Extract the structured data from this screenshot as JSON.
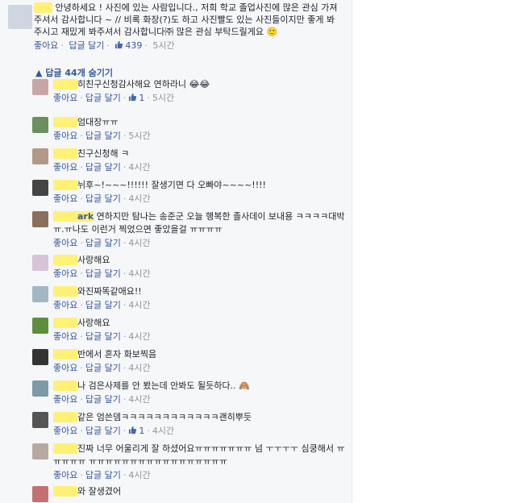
{
  "main_comment": {
    "text": "안녕하세요 ! 사진에 있는 사람입니다., 저희 학교 졸업사진에 많은 관심 가져주셔서 감사합니다 ~ // 비록 화장(?)도 하고 사진빨도 있는 사진들이지만 좋게 봐주시고 재밌게 봐주셔서 감사합니다㈜ 많은 관심 부탁드릴게요 🙂",
    "like_label": "좋아요",
    "reply_label": "답글 달기",
    "likes": "439",
    "time": "5시간"
  },
  "replies_toggle": "답글 44개 숨기기",
  "replies": [
    {
      "name": "",
      "text": "히친구신청감사해요 연하라니 😂😂",
      "likes": "1",
      "time": "5시간",
      "avatar_color": "#c9a6a6"
    },
    {
      "name": "",
      "text": "엄대장ㅠㅠ",
      "likes": "",
      "time": "5시간",
      "avatar_color": "#6b8f5e"
    },
    {
      "name": "",
      "text": "친구신청해 ㅋ",
      "likes": "",
      "time": "4시간",
      "avatar_color": "#b49a86"
    },
    {
      "name": "",
      "text": "뉘후~!~~~!!!!!! 잘생기면 다 오빠야~~~~!!!!",
      "likes": "",
      "time": "4시간",
      "avatar_color": "#444444"
    },
    {
      "name": "ark",
      "text": "연하지만 탐나는 송준군 오늘 행복한 졸사데이 보내용 ㅋㅋㅋㅋ대박 ㅠ.ㅠ나도 이런거 찍었으면 좋았을걸 ㅠㅠㅠㅠ",
      "likes": "",
      "time": "4시간",
      "avatar_color": "#8a6f5a"
    },
    {
      "name": "",
      "text": "사랑해요",
      "likes": "",
      "time": "4시간",
      "avatar_color": "#d7c4d9"
    },
    {
      "name": "",
      "text": "와진짜똑같애요!!",
      "likes": "",
      "time": "4시간",
      "avatar_color": "#a3b6c4"
    },
    {
      "name": "",
      "text": "사랑해요",
      "likes": "",
      "time": "4시간",
      "avatar_color": "#5e8f3e"
    },
    {
      "name": "",
      "text": "반에서 혼자 화보찍음",
      "likes": "",
      "time": "4시간",
      "avatar_color": "#333333"
    },
    {
      "name": "",
      "text": "나 검은사제를 안 봤는데 안봐도 될듯하다.. 🙈",
      "likes": "",
      "time": "4시간",
      "avatar_color": "#7c9aa8"
    },
    {
      "name": "",
      "text": "같은 엄쓴뎀ㅋㅋㅋㅋㅋㅋㅋㅋㅋㅋㅋㅋ괜히뿌듯",
      "likes": "1",
      "time": "4시간",
      "avatar_color": "#555555"
    },
    {
      "name": "",
      "text": "진짜 너무 어울리게 잘 하셨어요ㅠㅠㅠㅠㅠㅠㅠ 넘 ㅜㅜㅜㅜ 심쿵해서 ㅠㅠㅠㅠㅠ ㅠㅠㅠㅠㅠㅠㅠㅠㅠㅠㅠㅠㅠㅠㅠㅠㅠ",
      "likes": "",
      "time": "4시간",
      "avatar_color": "#b8a9a0"
    },
    {
      "name": "",
      "text": "와 잘생겼어",
      "likes": "",
      "time": "",
      "avatar_color": "#c47070"
    }
  ],
  "labels": {
    "like": "좋아요",
    "reply": "답글 달기"
  },
  "colors": {
    "link": "#365899",
    "highlight": "#fff176"
  }
}
